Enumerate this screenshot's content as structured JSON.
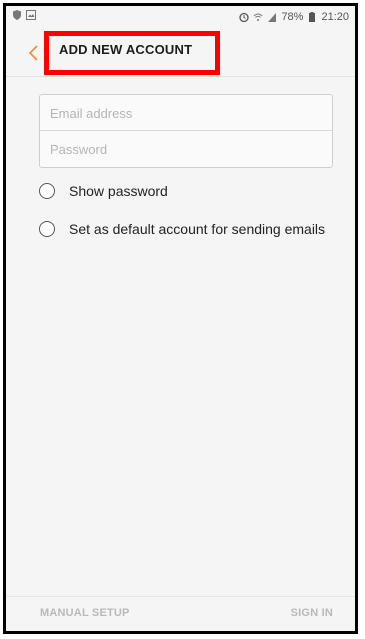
{
  "status_bar": {
    "battery": "78%",
    "time": "21:20"
  },
  "header": {
    "title": "ADD NEW ACCOUNT"
  },
  "form": {
    "email_placeholder": "Email address",
    "password_placeholder": "Password"
  },
  "options": {
    "show_password": "Show password",
    "default_account": "Set as default account for sending emails"
  },
  "footer": {
    "manual_setup": "MANUAL SETUP",
    "sign_in": "SIGN IN"
  },
  "colors": {
    "highlight": "#ff0000",
    "back_arrow": "#f08a3a"
  },
  "icons": {
    "status_left": [
      "shield-icon",
      "image-icon"
    ],
    "status_right": [
      "alarm-icon",
      "wifi-icon",
      "signal-icon",
      "battery-icon"
    ]
  }
}
